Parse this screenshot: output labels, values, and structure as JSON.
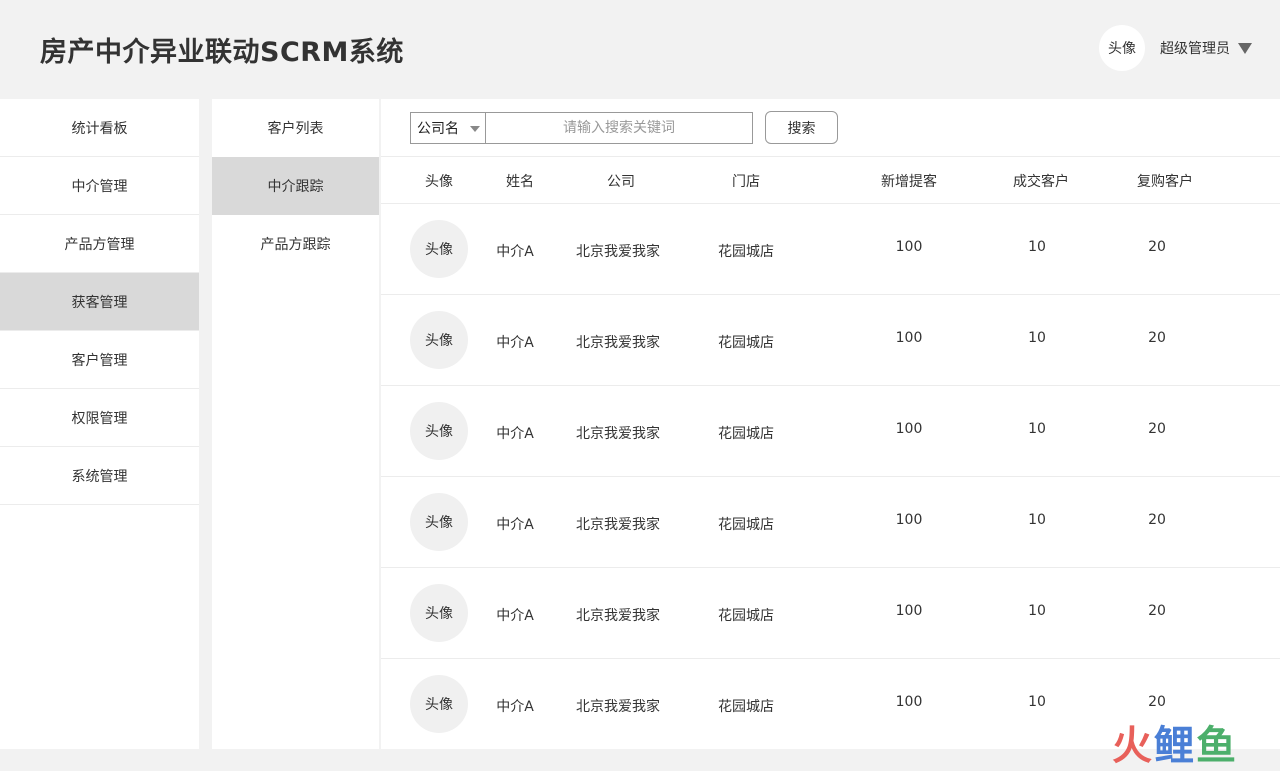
{
  "header": {
    "title": "房产中介异业联动SCRM系统",
    "avatar_label": "头像",
    "user_name": "超级管理员"
  },
  "sidebar": {
    "items": [
      {
        "label": "统计看板",
        "active": false
      },
      {
        "label": "中介管理",
        "active": false
      },
      {
        "label": "产品方管理",
        "active": false
      },
      {
        "label": "获客管理",
        "active": true
      },
      {
        "label": "客户管理",
        "active": false
      },
      {
        "label": "权限管理",
        "active": false
      },
      {
        "label": "系统管理",
        "active": false
      }
    ]
  },
  "subnav": {
    "items": [
      {
        "label": "客户列表",
        "active": false
      },
      {
        "label": "中介跟踪",
        "active": true
      },
      {
        "label": "产品方跟踪",
        "active": false
      }
    ]
  },
  "search": {
    "filter_value": "公司名",
    "placeholder": "请输入搜索关键词",
    "button_label": "搜索"
  },
  "table": {
    "columns": [
      "头像",
      "姓名",
      "公司",
      "门店",
      "新增提客",
      "成交客户",
      "复购客户"
    ],
    "rows": [
      {
        "avatar": "头像",
        "name": "中介A",
        "company": "北京我爱我家",
        "store": "花园城店",
        "new_leads": "100",
        "deals": "10",
        "repurchase": "20"
      },
      {
        "avatar": "头像",
        "name": "中介A",
        "company": "北京我爱我家",
        "store": "花园城店",
        "new_leads": "100",
        "deals": "10",
        "repurchase": "20"
      },
      {
        "avatar": "头像",
        "name": "中介A",
        "company": "北京我爱我家",
        "store": "花园城店",
        "new_leads": "100",
        "deals": "10",
        "repurchase": "20"
      },
      {
        "avatar": "头像",
        "name": "中介A",
        "company": "北京我爱我家",
        "store": "花园城店",
        "new_leads": "100",
        "deals": "10",
        "repurchase": "20"
      },
      {
        "avatar": "头像",
        "name": "中介A",
        "company": "北京我爱我家",
        "store": "花园城店",
        "new_leads": "100",
        "deals": "10",
        "repurchase": "20"
      },
      {
        "avatar": "头像",
        "name": "中介A",
        "company": "北京我爱我家",
        "store": "花园城店",
        "new_leads": "100",
        "deals": "10",
        "repurchase": "20"
      }
    ]
  },
  "watermark": {
    "part1": "火",
    "part2": "鲤",
    "part3": "鱼"
  },
  "colors": {
    "active_bg": "#d9d9d9",
    "page_bg": "#f2f2f2",
    "watermark_red": "#e8605a",
    "watermark_blue": "#4a7fd6",
    "watermark_green": "#4caf6b"
  }
}
